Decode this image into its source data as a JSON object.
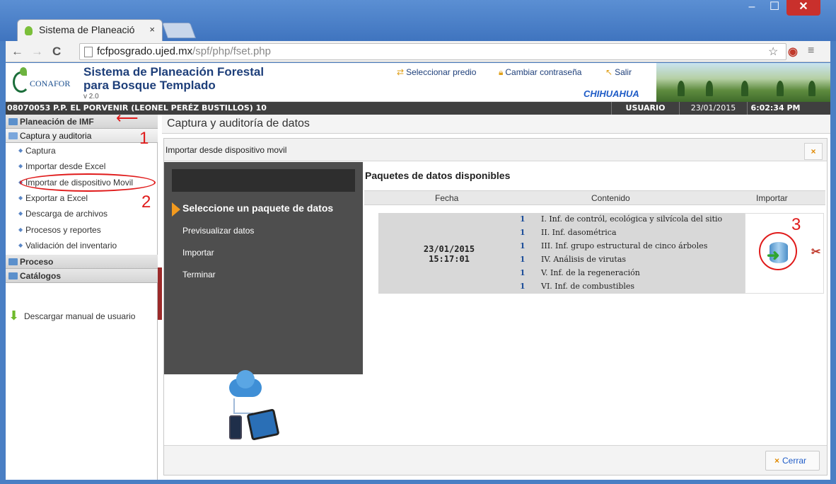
{
  "browser": {
    "tab_title": "Sistema de Planeació",
    "tab_close": "×",
    "url_host": "fcfposgrado.ujed.mx",
    "url_path": "/spf/php/fset.php",
    "window_min": "–",
    "window_max": "☐",
    "window_close": "✕"
  },
  "header": {
    "logo_text": "CONAFOR",
    "title_line1": "Sistema de Planeación Forestal",
    "title_line2": "para Bosque Templado",
    "version": "v 2.0",
    "link_select": "Seleccionar predio",
    "link_password": "Cambiar contraseña",
    "link_exit": "Salir",
    "state": "CHIHUAHUA"
  },
  "infobar": {
    "predio": "08070053 P.P. EL PORVENIR (LEONEL PERÉZ BUSTILLOS) 10",
    "user_label": "USUARIO",
    "date": "23/01/2015",
    "time": "6:02:34 PM"
  },
  "sidebar": {
    "sections": [
      {
        "label": "Planeación de IMF"
      },
      {
        "label": "Captura y auditoria"
      },
      {
        "label": "Proceso"
      },
      {
        "label": "Catálogos"
      }
    ],
    "subitems": [
      {
        "label": "Captura"
      },
      {
        "label": "Importar desde Excel"
      },
      {
        "label": "Importar de dispositivo Movil"
      },
      {
        "label": "Exportar a Excel"
      },
      {
        "label": "Descarga de archivos"
      },
      {
        "label": "Procesos y reportes"
      },
      {
        "label": "Validación del inventario"
      }
    ],
    "download_manual": "Descargar manual de usuario"
  },
  "annotations": {
    "one": "1",
    "two": "2",
    "three": "3"
  },
  "main": {
    "title": "Captura y auditoría de datos",
    "dialog_title": "Importar desde dispositivo movil",
    "dialog_close": "×",
    "wizard_steps": [
      {
        "label": "Seleccione un paquete de datos"
      },
      {
        "label": "Previsualizar datos"
      },
      {
        "label": "Importar"
      },
      {
        "label": "Terminar"
      }
    ],
    "content_title": "Paquetes de datos disponibles",
    "columns": {
      "fecha": "Fecha",
      "contenido": "Contenido",
      "importar": "Importar"
    },
    "package": {
      "date": "23/01/2015",
      "time": "15:17:01",
      "items": [
        {
          "n": "1",
          "label": "I. Inf. de contról, ecológica y silvícola del sitio"
        },
        {
          "n": "1",
          "label": "II. Inf. dasométrica"
        },
        {
          "n": "1",
          "label": "III. Inf. grupo estructural de cinco árboles"
        },
        {
          "n": "1",
          "label": "IV. Análisis de virutas"
        },
        {
          "n": "1",
          "label": "V. Inf. de la regeneración"
        },
        {
          "n": "1",
          "label": "VI. Inf. de combustibles"
        }
      ]
    },
    "close_button": "Cerrar"
  },
  "colors": {
    "accent": "#1e3f7a",
    "annotation": "#e01b1b",
    "wizard_bg": "#4e4e4e",
    "active_marker": "#f39a1e"
  }
}
